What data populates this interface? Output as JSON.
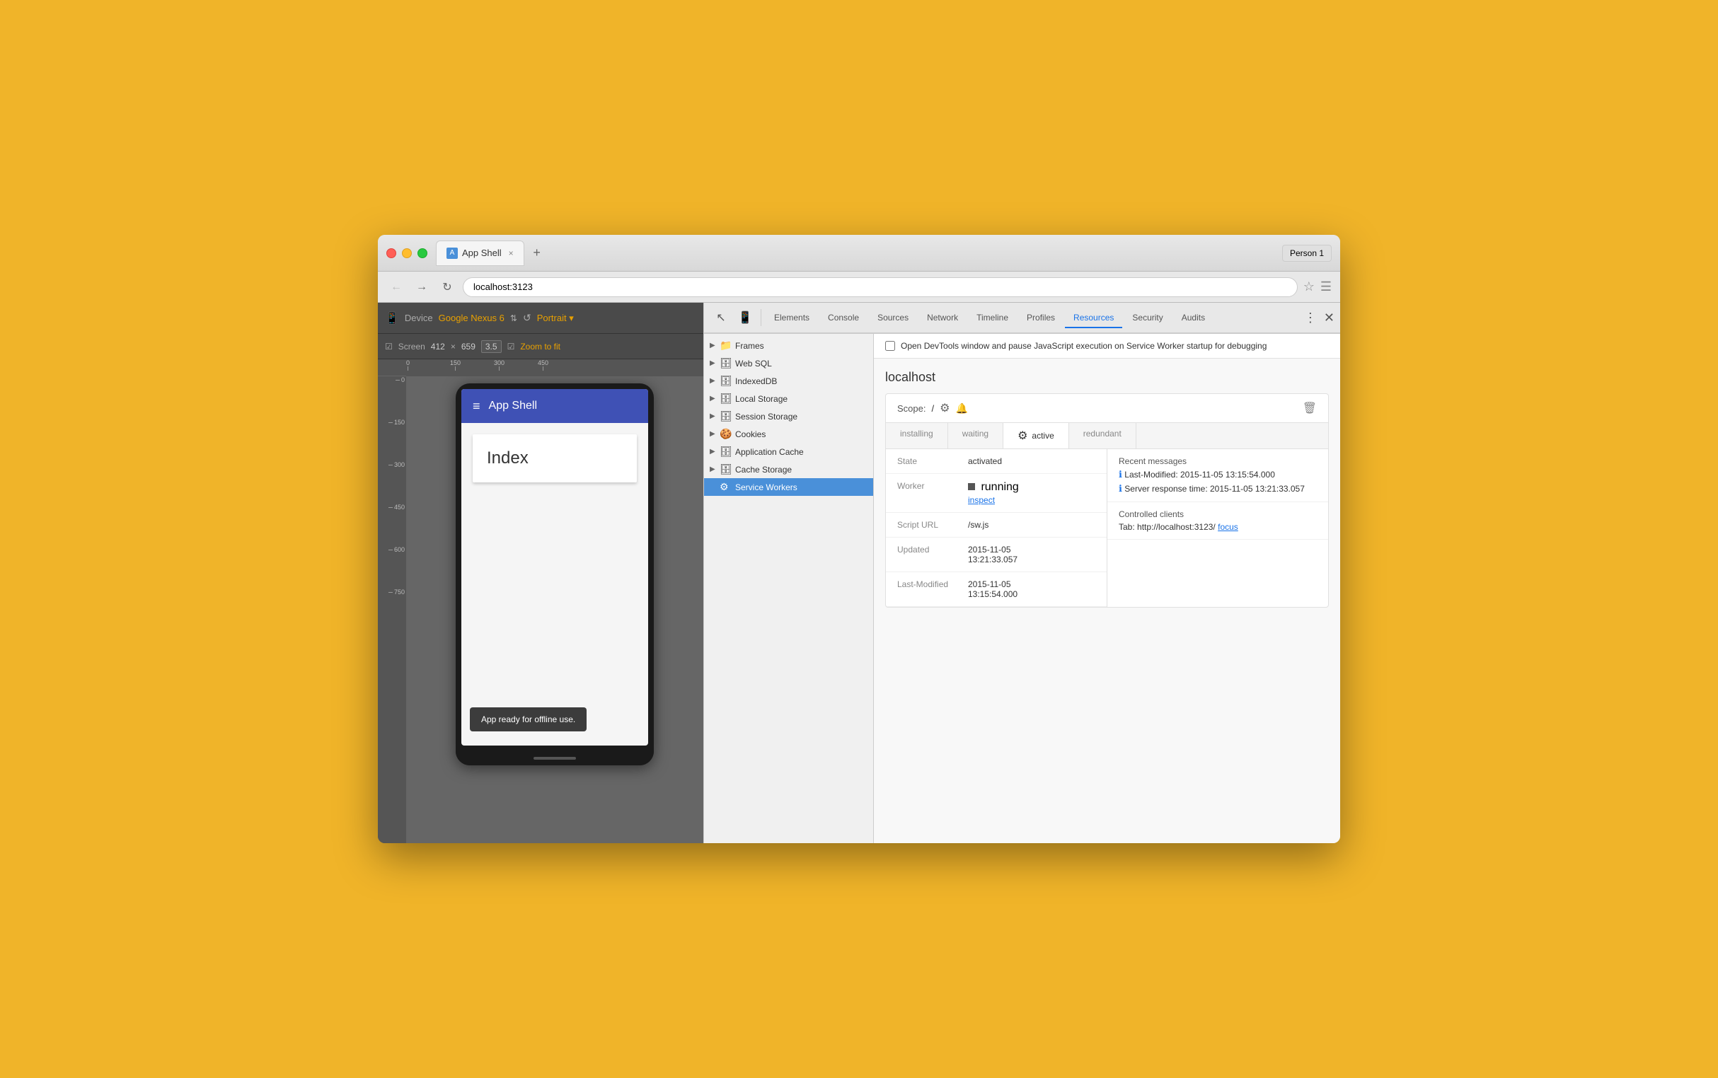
{
  "window": {
    "title": "App Shell",
    "person": "Person 1",
    "address": "localhost:3123",
    "tab_close": "×"
  },
  "device_toolbar": {
    "device_label": "Device",
    "device_name": "Google Nexus 6",
    "portrait_label": "Portrait ▾",
    "screen_label": "Screen",
    "width": "412",
    "cross": "×",
    "height": "659",
    "zoom_factor": "3.5",
    "zoom_to_fit": "Zoom to fit",
    "ruler_marks": [
      "0",
      "150",
      "300",
      "450"
    ],
    "ruler_side_marks": [
      "0",
      "150",
      "300",
      "450",
      "600",
      "750"
    ]
  },
  "phone": {
    "app_title": "App Shell",
    "hamburger": "≡",
    "index_label": "Index",
    "offline_toast": "App ready for offline use."
  },
  "devtools": {
    "tabs": [
      {
        "id": "elements",
        "label": "Elements"
      },
      {
        "id": "console",
        "label": "Console"
      },
      {
        "id": "sources",
        "label": "Sources"
      },
      {
        "id": "network",
        "label": "Network"
      },
      {
        "id": "timeline",
        "label": "Timeline"
      },
      {
        "id": "profiles",
        "label": "Profiles"
      },
      {
        "id": "resources",
        "label": "Resources",
        "active": true
      },
      {
        "id": "security",
        "label": "Security"
      },
      {
        "id": "audits",
        "label": "Audits"
      }
    ],
    "notice": "Open DevTools window and pause JavaScript execution on Service Worker startup for debugging",
    "resource_tree": [
      {
        "id": "frames",
        "label": "Frames",
        "icon": "📁",
        "expandable": true
      },
      {
        "id": "web-sql",
        "label": "Web SQL",
        "icon": "🗄",
        "expandable": true
      },
      {
        "id": "indexeddb",
        "label": "IndexedDB",
        "icon": "🗄",
        "expandable": true
      },
      {
        "id": "local-storage",
        "label": "Local Storage",
        "icon": "🗄",
        "expandable": true
      },
      {
        "id": "session-storage",
        "label": "Session Storage",
        "icon": "🗄",
        "expandable": true
      },
      {
        "id": "cookies",
        "label": "Cookies",
        "icon": "🍪",
        "expandable": true
      },
      {
        "id": "application-cache",
        "label": "Application Cache",
        "icon": "🗄",
        "expandable": true
      },
      {
        "id": "cache-storage",
        "label": "Cache Storage",
        "icon": "🗄",
        "expandable": true
      },
      {
        "id": "service-workers",
        "label": "Service Workers",
        "icon": "⚙",
        "expandable": false,
        "selected": true
      }
    ],
    "sw": {
      "host": "localhost",
      "notice_text": "Open DevTools window and pause JavaScript execution on Service Worker startup for debugging",
      "scope_label": "Scope:",
      "scope_value": "/",
      "status_tabs": [
        {
          "label": "installing"
        },
        {
          "label": "waiting"
        },
        {
          "label": "active",
          "active": true,
          "icon": "⚙"
        },
        {
          "label": "redundant"
        }
      ],
      "state_label": "State",
      "state_value": "activated",
      "recent_messages_label": "Recent messages",
      "messages": [
        "Last-Modified: 2015-11-05 13:15:54.000",
        "Server response time: 2015-11-05 13:21:33.057"
      ],
      "worker_label": "Worker",
      "worker_status": "running",
      "worker_inspect": "inspect",
      "controlled_clients_label": "Controlled clients",
      "client_tab_prefix": "Tab: http://localhost:3123/",
      "client_focus_link": "focus",
      "script_url_label": "Script URL",
      "script_url_value": "/sw.js",
      "updated_label": "Updated",
      "updated_value": "2015-11-05\n13:21:33.057",
      "last_modified_label": "Last-Modified",
      "last_modified_value": "2015-11-05\n13:15:54.000"
    }
  }
}
